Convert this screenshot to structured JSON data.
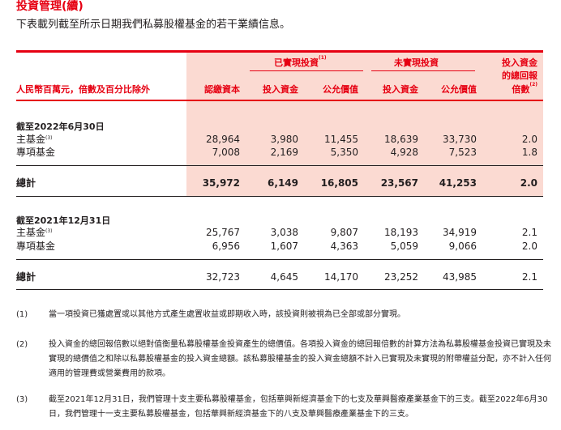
{
  "header": {
    "title": "投資管理(續)",
    "subtitle": "下表載列截至所示日期我們私募股權基金的若干業績信息。"
  },
  "table": {
    "group_realized": "已實現投資",
    "group_realized_note": "(1)",
    "group_unrealized": "未實現投資",
    "gross_moic_line1": "投入資金",
    "gross_moic_line2": "的總回報",
    "gross_moic_line3": "倍數",
    "gross_moic_note": "(2)",
    "unit_label": "人民幣百萬元，倍數及百分比除外",
    "col_committed": "認繳資本",
    "col_realized_invested": "投入資金",
    "col_realized_fv": "公允價值",
    "col_unrealized_invested": "投入資金",
    "col_unrealized_fv": "公允價值",
    "sections": [
      {
        "heading": "截至2022年6月30日",
        "rows": [
          {
            "label": "主基金",
            "note": "(3)",
            "values": [
              "28,964",
              "3,980",
              "11,455",
              "18,639",
              "33,730",
              "2.0"
            ]
          },
          {
            "label": "專項基金",
            "note": "",
            "values": [
              "7,008",
              "2,169",
              "5,350",
              "4,928",
              "7,523",
              "1.8"
            ]
          }
        ],
        "total": {
          "label": "總計",
          "values": [
            "35,972",
            "6,149",
            "16,805",
            "23,567",
            "41,253",
            "2.0"
          ]
        }
      },
      {
        "heading": "截至2021年12月31日",
        "rows": [
          {
            "label": "主基金",
            "note": "(3)",
            "values": [
              "25,767",
              "3,038",
              "9,807",
              "18,193",
              "34,919",
              "2.1"
            ]
          },
          {
            "label": "專項基金",
            "note": "",
            "values": [
              "6,956",
              "1,607",
              "4,363",
              "5,059",
              "9,066",
              "2.0"
            ]
          }
        ],
        "total": {
          "label": "總計",
          "values": [
            "32,723",
            "4,645",
            "14,170",
            "23,252",
            "43,985",
            "2.1"
          ]
        }
      }
    ]
  },
  "notes": [
    {
      "num": "(1)",
      "text": "當一項投資已獲處置或以其他方式產生處置收益或即期收入時，該投資則被視為已全部或部分實現。"
    },
    {
      "num": "(2)",
      "text": "投入資金的總回報倍數以絕對值衡量私募股權基金投資產生的總價值。各項投入資金的總回報倍數的計算方法為私募股權基金投資已實現及未實現的總價值之和除以私募股權基金的投入資金總額。該私募股權基金的投入資金總額不計入已實現及未實現的附帶權益分配，亦不計入任何適用的管理費或營業費用的款項。"
    },
    {
      "num": "(3)",
      "text": "截至2021年12月31日，我們管理十支主要私募股權基金，包括華興新經濟基金下的七支及華興醫療產業基金下的三支。截至2022年6月30日，我們管理十一支主要私募股權基金，包括華興新經濟基金下的八支及華興醫療產業基金下的三支。"
    }
  ]
}
